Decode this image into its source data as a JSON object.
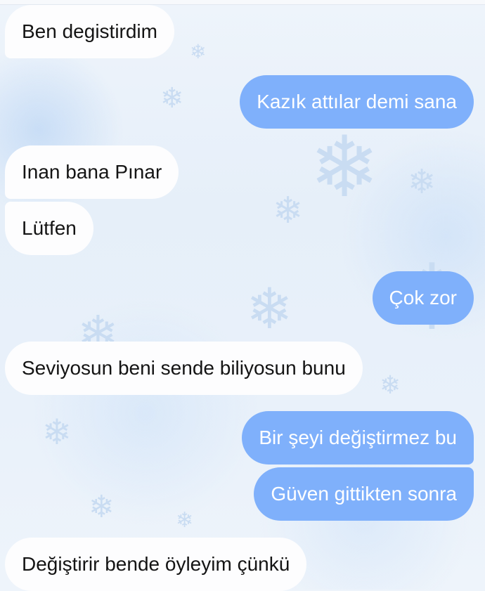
{
  "chat": {
    "messages": [
      {
        "direction": "incoming",
        "text": "Ben degistirdim"
      },
      {
        "direction": "outgoing",
        "text": "Kazık attılar demi sana"
      },
      {
        "direction": "incoming",
        "text": "Inan bana Pınar"
      },
      {
        "direction": "incoming",
        "text": "Lütfen"
      },
      {
        "direction": "outgoing",
        "text": "Çok zor"
      },
      {
        "direction": "incoming",
        "text": "Seviyosun beni sende biliyosun bunu"
      },
      {
        "direction": "outgoing",
        "text": "Bir şeyi değiştirmez bu"
      },
      {
        "direction": "outgoing",
        "text": "Güven gittikten sonra"
      },
      {
        "direction": "incoming",
        "text": "Değiştirir bende öyleyim çünkü"
      }
    ]
  },
  "theme": {
    "incoming_bubble_color": "#fdfdfe",
    "outgoing_bubble_color": "#7fb0fb",
    "background_color": "#e9f1fa",
    "wallpaper_icon": "snowflake-icon"
  }
}
